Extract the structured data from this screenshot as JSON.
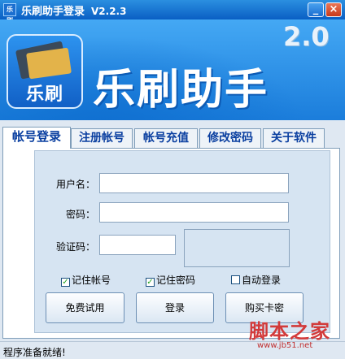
{
  "titlebar": {
    "icon_text": "乐刷",
    "title": "乐刷助手登录",
    "version": "V2.2.3",
    "minimize": "_",
    "close": "×"
  },
  "banner": {
    "logo_text": "乐刷",
    "title": "乐刷助手",
    "version": "2.0"
  },
  "tabs": [
    "帐号登录",
    "注册帐号",
    "帐号充值",
    "修改密码",
    "关于软件"
  ],
  "active_tab": 0,
  "form": {
    "username_label": "用户名：",
    "username_value": "",
    "password_label": "密码：",
    "password_value": "",
    "captcha_label": "验证码：",
    "captcha_value": ""
  },
  "checkboxes": [
    {
      "label": "记住帐号",
      "checked": true
    },
    {
      "label": "记住密码",
      "checked": true
    },
    {
      "label": "自动登录",
      "checked": false
    }
  ],
  "buttons": {
    "trial": "免费试用",
    "login": "登录",
    "buy": "购买卡密"
  },
  "status": {
    "text": "程序准备就绪!"
  },
  "watermark": {
    "text": "脚本之家",
    "url": "www.jb51.net"
  },
  "colors": {
    "title_bar": "#0a5fc4",
    "banner": "#2b8fe0",
    "tab_text": "#0a3fa0"
  }
}
